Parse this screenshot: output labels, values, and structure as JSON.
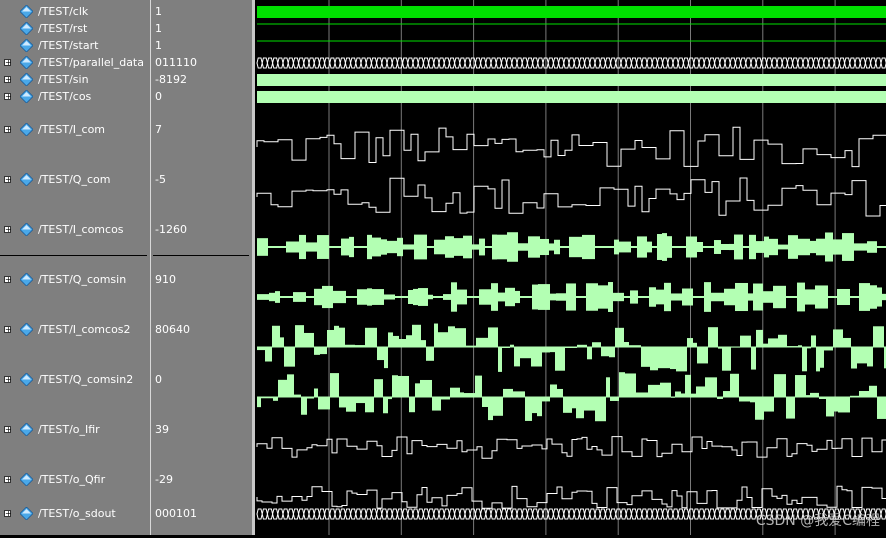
{
  "signals": [
    {
      "name": "/TEST/clk",
      "value": "1",
      "expandable": false,
      "kind": "clock"
    },
    {
      "name": "/TEST/rst",
      "value": "1",
      "expandable": false,
      "kind": "high"
    },
    {
      "name": "/TEST/start",
      "value": "1",
      "expandable": false,
      "kind": "high"
    },
    {
      "name": "/TEST/parallel_data",
      "value": "011110",
      "expandable": true,
      "kind": "bus"
    },
    {
      "name": "/TEST/sin",
      "value": "-8192",
      "expandable": true,
      "kind": "band"
    },
    {
      "name": "/TEST/cos",
      "value": "0",
      "expandable": true,
      "kind": "band"
    },
    {
      "name": "/TEST/I_com",
      "value": "7",
      "expandable": true,
      "kind": "step"
    },
    {
      "name": "/TEST/Q_com",
      "value": "-5",
      "expandable": true,
      "kind": "step"
    },
    {
      "name": "/TEST/I_comcos",
      "value": "-1260",
      "expandable": true,
      "kind": "sym"
    },
    {
      "name": "/TEST/Q_comsin",
      "value": "910",
      "expandable": true,
      "kind": "sym"
    },
    {
      "name": "/TEST/I_comcos2",
      "value": "80640",
      "expandable": true,
      "kind": "bars"
    },
    {
      "name": "/TEST/Q_comsin2",
      "value": "0",
      "expandable": true,
      "kind": "bars"
    },
    {
      "name": "/TEST/o_Ifir",
      "value": "39",
      "expandable": true,
      "kind": "fine"
    },
    {
      "name": "/TEST/o_Qfir",
      "value": "-29",
      "expandable": true,
      "kind": "fine"
    },
    {
      "name": "/TEST/o_sdout",
      "value": "000101",
      "expandable": true,
      "kind": "bus"
    }
  ],
  "colors": {
    "clock": "#00e000",
    "wave_line": "#ffffff",
    "analog_fill": "#b3ffb3",
    "bus_line": "#ffffff",
    "grid": "#7a7a7a",
    "panel": "#7f7f7f",
    "diamond": "#4aa8e8"
  },
  "icons": {
    "expand": "plus-box-icon",
    "signal": "diamond-signal-icon"
  },
  "watermark": "CSDN @我爱C编程"
}
